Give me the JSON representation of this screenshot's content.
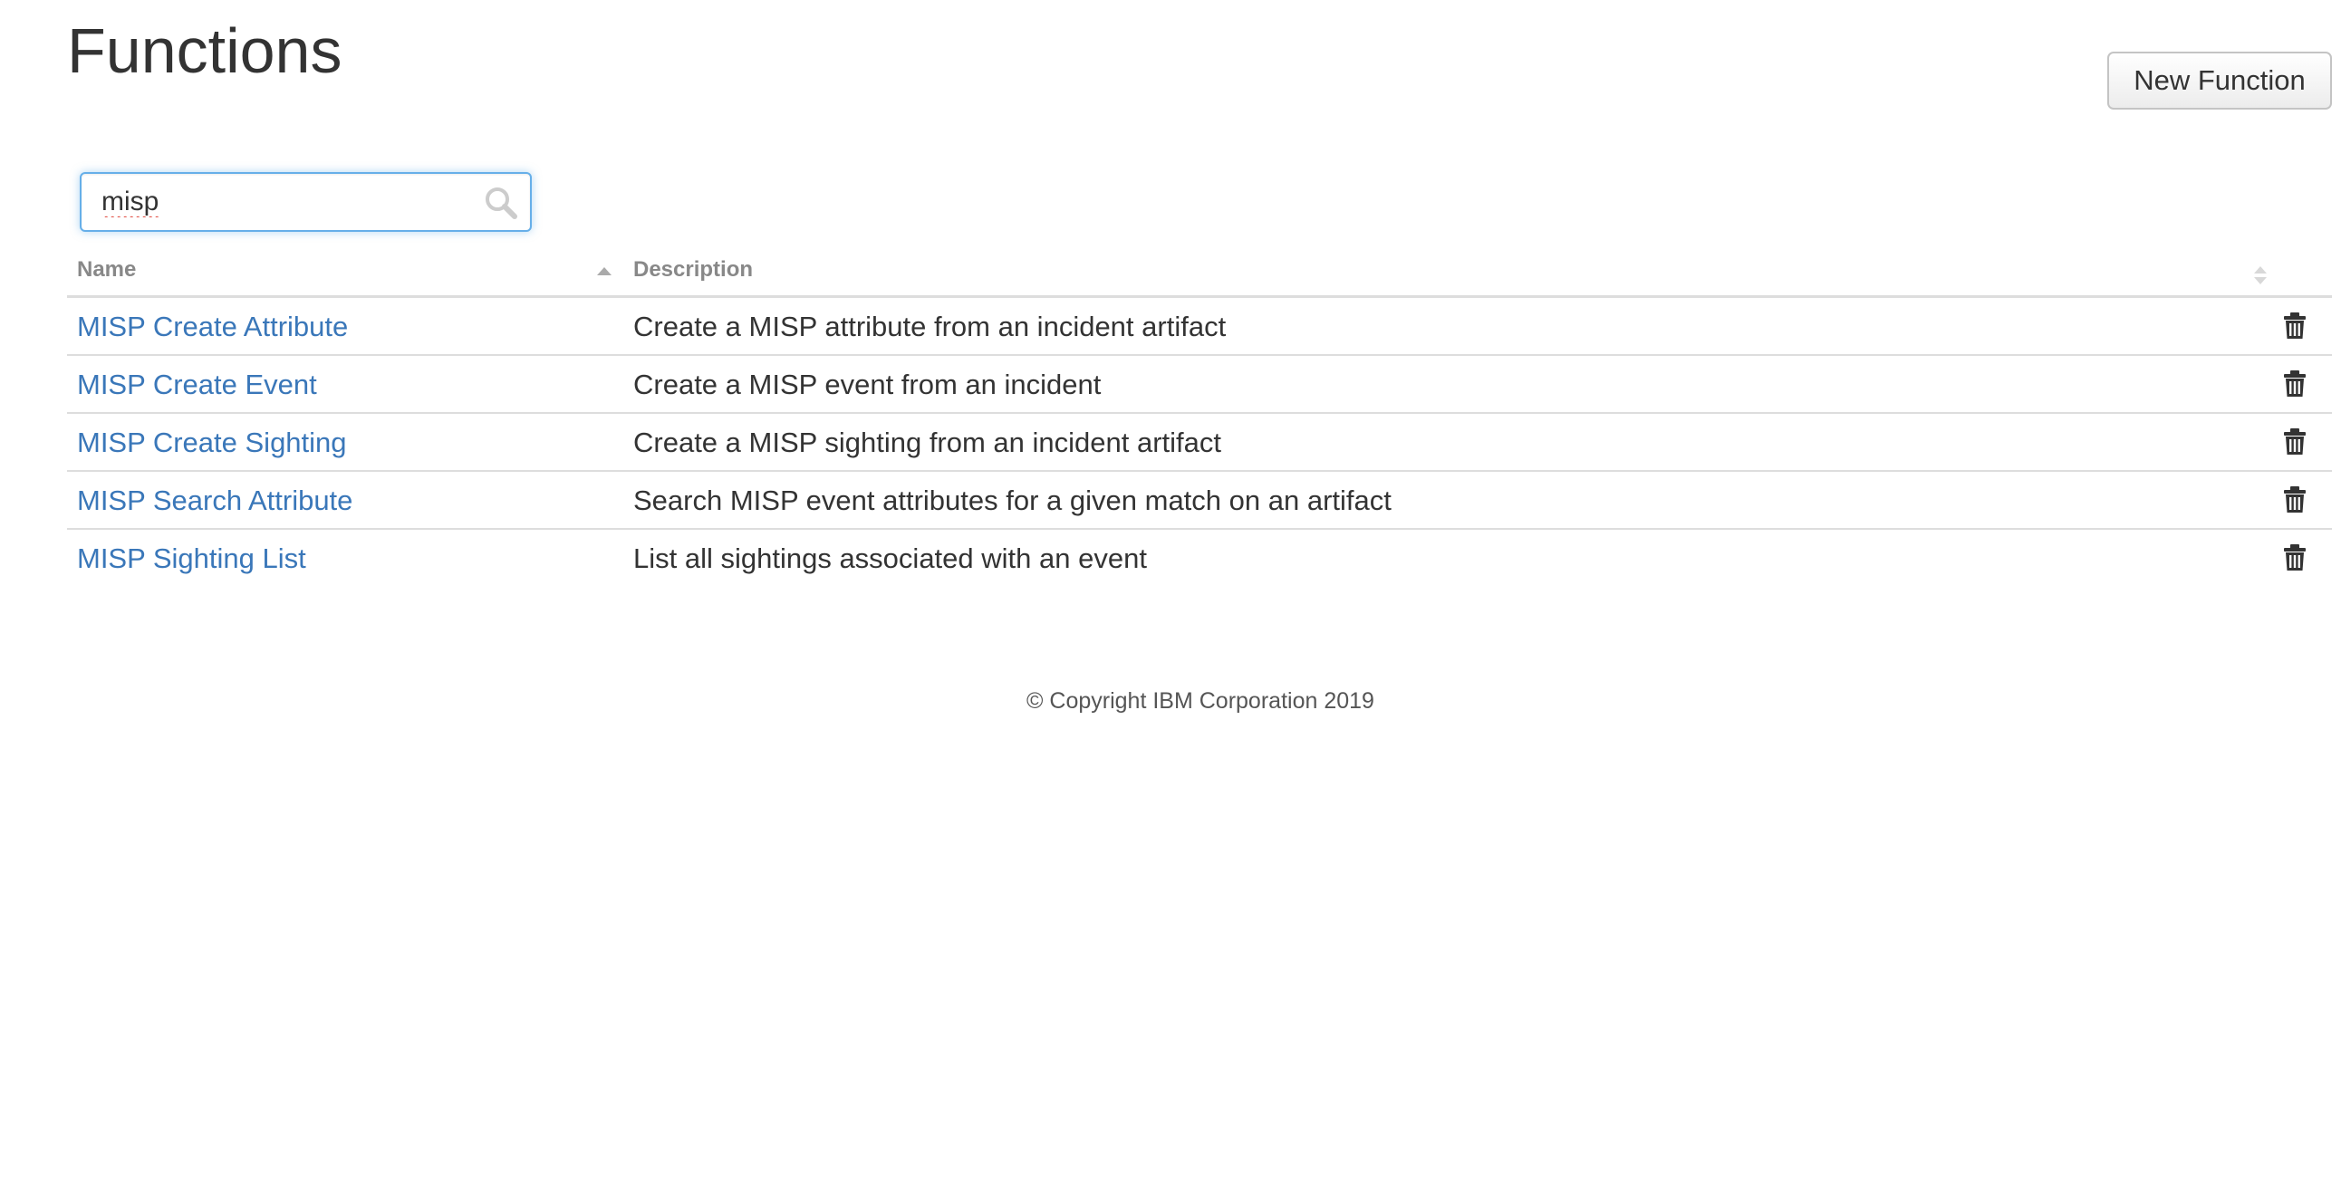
{
  "page": {
    "title": "Functions",
    "new_button_label": "New Function"
  },
  "search": {
    "value": "misp",
    "icon": "search-icon"
  },
  "table": {
    "columns": [
      "Name",
      "Description"
    ],
    "sort": {
      "column": "Name",
      "direction": "ascending"
    },
    "rows": [
      {
        "name": "MISP Create Attribute",
        "description": "Create a MISP attribute from an incident artifact",
        "action_icon": "trash-icon"
      },
      {
        "name": "MISP Create Event",
        "description": "Create a MISP event from an incident",
        "action_icon": "trash-icon"
      },
      {
        "name": "MISP Create Sighting",
        "description": "Create a MISP sighting from an incident artifact",
        "action_icon": "trash-icon"
      },
      {
        "name": "MISP Search Attribute",
        "description": "Search MISP event attributes for a given match on an artifact",
        "action_icon": "trash-icon"
      },
      {
        "name": "MISP Sighting List",
        "description": "List all sightings associated with an event",
        "action_icon": "trash-icon"
      }
    ]
  },
  "footer": {
    "copyright": "© Copyright IBM Corporation 2019"
  },
  "colors": {
    "link": "#3a77b9",
    "focus_border": "#66afe9",
    "header_text": "#888888",
    "row_border": "#dddddd"
  }
}
